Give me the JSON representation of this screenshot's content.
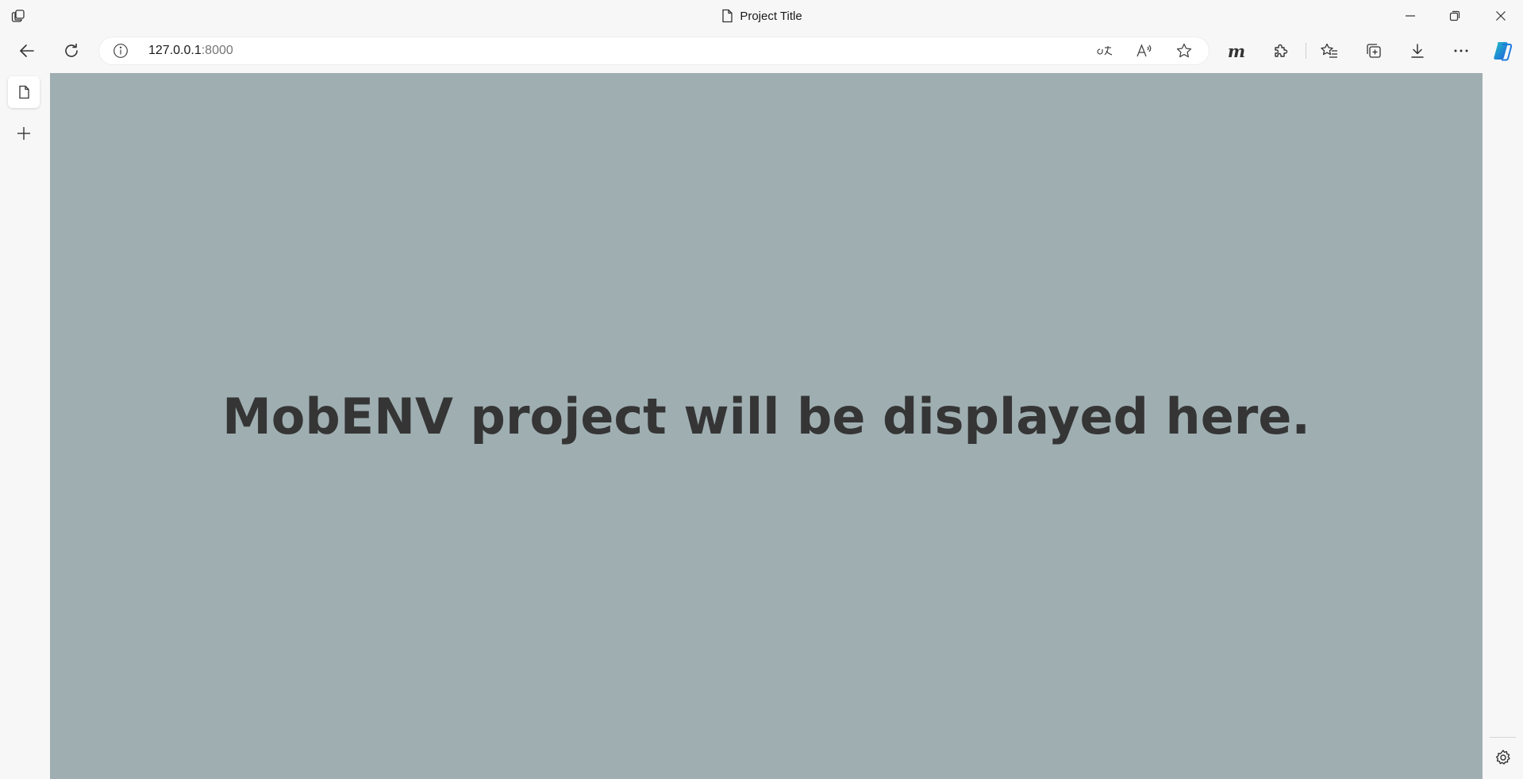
{
  "window": {
    "title": "Project Title",
    "workspaces_icon": "workspaces-icon",
    "controls": [
      "minimize-icon",
      "restore-icon",
      "close-icon"
    ]
  },
  "toolbar": {
    "back_icon": "back-arrow-icon",
    "refresh_icon": "refresh-icon",
    "address": {
      "host": "127.0.0.1",
      "port": ":8000",
      "info_icon": "info-icon"
    },
    "address_icons": [
      "translate-icon",
      "read-aloud-icon",
      "favorite-star-icon"
    ],
    "right_icons": [
      "extension-m-icon",
      "extensions-puzzle-icon",
      "favorites-icon",
      "collections-icon",
      "downloads-icon",
      "more-icon",
      "copilot-icon"
    ],
    "extension_m_label": "m"
  },
  "sidebar": {
    "active_tab_icon": "page-icon",
    "new_tab_icon": "plus-icon"
  },
  "main": {
    "message": "MobENV project will be displayed here.",
    "background": "#9faeb1",
    "text_color": "#353535"
  },
  "right_rail": {
    "settings_icon": "settings-gear-icon"
  },
  "colors": {
    "chrome": "#f7f7f7",
    "copilot_blue": "#1f7ae0",
    "copilot_teal": "#22c1c3"
  }
}
